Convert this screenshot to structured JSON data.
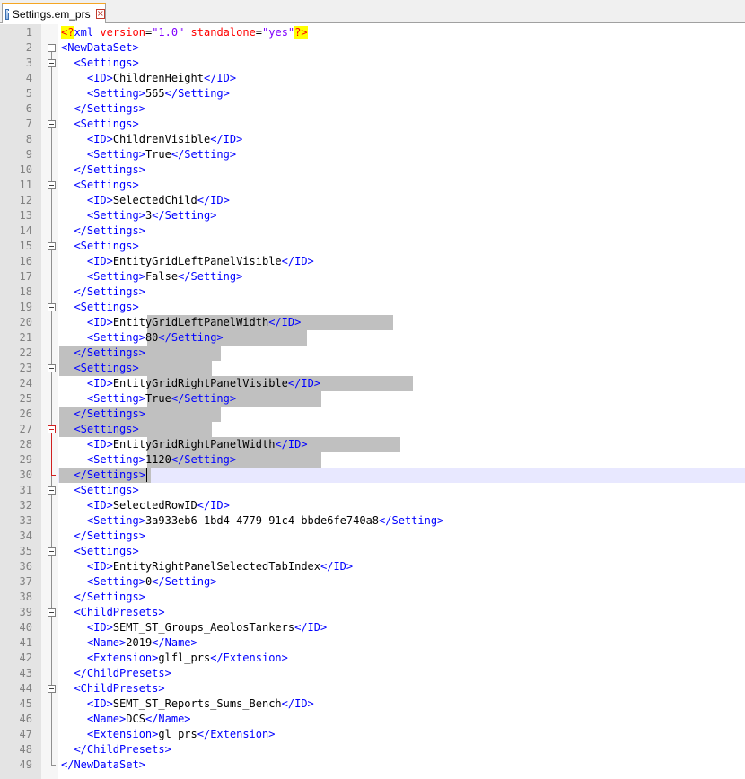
{
  "tab": {
    "label": "Settings.em_prs",
    "icon": "save-icon",
    "close_icon": "close-icon"
  },
  "colors": {
    "tag": "#0000ff",
    "attribute": "#ff0000",
    "attribute_value": "#8000ff",
    "text": "#000000",
    "selection": "#c0c0c0",
    "current_line": "#e8e8ff",
    "pi_highlight": "#ffff00"
  },
  "editor": {
    "current_line": 30,
    "lines": [
      {
        "n": "1",
        "t": "<?xml version=\"1.0\" standalone=\"yes\"?>"
      },
      {
        "n": "2",
        "t": "<NewDataSet>"
      },
      {
        "n": "3",
        "t": "  <Settings>"
      },
      {
        "n": "4",
        "t": "    <ID>ChildrenHeight</ID>"
      },
      {
        "n": "5",
        "t": "    <Setting>565</Setting>"
      },
      {
        "n": "6",
        "t": "  </Settings>"
      },
      {
        "n": "7",
        "t": "  <Settings>"
      },
      {
        "n": "8",
        "t": "    <ID>ChildrenVisible</ID>"
      },
      {
        "n": "9",
        "t": "    <Setting>True</Setting>"
      },
      {
        "n": "10",
        "t": "  </Settings>"
      },
      {
        "n": "11",
        "t": "  <Settings>"
      },
      {
        "n": "12",
        "t": "    <ID>SelectedChild</ID>"
      },
      {
        "n": "13",
        "t": "    <Setting>3</Setting>"
      },
      {
        "n": "14",
        "t": "  </Settings>"
      },
      {
        "n": "15",
        "t": "  <Settings>"
      },
      {
        "n": "16",
        "t": "    <ID>EntityGridLeftPanelVisible</ID>"
      },
      {
        "n": "17",
        "t": "    <Setting>False</Setting>"
      },
      {
        "n": "18",
        "t": "  </Settings>"
      },
      {
        "n": "19",
        "t": "  <Settings>"
      },
      {
        "n": "20",
        "t": "    <ID>EntityGridLeftPanelWidth</ID>"
      },
      {
        "n": "21",
        "t": "    <Setting>80</Setting>"
      },
      {
        "n": "22",
        "t": "  </Settings>"
      },
      {
        "n": "23",
        "t": "  <Settings>"
      },
      {
        "n": "24",
        "t": "    <ID>EntityGridRightPanelVisible</ID>"
      },
      {
        "n": "25",
        "t": "    <Setting>True</Setting>"
      },
      {
        "n": "26",
        "t": "  </Settings>"
      },
      {
        "n": "27",
        "t": "  <Settings>"
      },
      {
        "n": "28",
        "t": "    <ID>EntityGridRightPanelWidth</ID>"
      },
      {
        "n": "29",
        "t": "    <Setting>1120</Setting>"
      },
      {
        "n": "30",
        "t": "  </Settings>"
      },
      {
        "n": "31",
        "t": "  <Settings>"
      },
      {
        "n": "32",
        "t": "    <ID>SelectedRowID</ID>"
      },
      {
        "n": "33",
        "t": "    <Setting>3a933eb6-1bd4-4779-91c4-bbde6fe740a8</Setting>"
      },
      {
        "n": "34",
        "t": "  </Settings>"
      },
      {
        "n": "35",
        "t": "  <Settings>"
      },
      {
        "n": "36",
        "t": "    <ID>EntityRightPanelSelectedTabIndex</ID>"
      },
      {
        "n": "37",
        "t": "    <Setting>0</Setting>"
      },
      {
        "n": "38",
        "t": "  </Settings>"
      },
      {
        "n": "39",
        "t": "  <ChildPresets>"
      },
      {
        "n": "40",
        "t": "    <ID>SEMT_ST_Groups_AeolosTankers</ID>"
      },
      {
        "n": "41",
        "t": "    <Name>2019</Name>"
      },
      {
        "n": "42",
        "t": "    <Extension>glfl_prs</Extension>"
      },
      {
        "n": "43",
        "t": "  </ChildPresets>"
      },
      {
        "n": "44",
        "t": "  <ChildPresets>"
      },
      {
        "n": "45",
        "t": "    <ID>SEMT_ST_Reports_Sums_Bench</ID>"
      },
      {
        "n": "46",
        "t": "    <Name>DCS</Name>"
      },
      {
        "n": "47",
        "t": "    <Extension>gl_prs</Extension>"
      },
      {
        "n": "48",
        "t": "  </ChildPresets>"
      },
      {
        "n": "49",
        "t": "</NewDataSet>"
      }
    ]
  }
}
